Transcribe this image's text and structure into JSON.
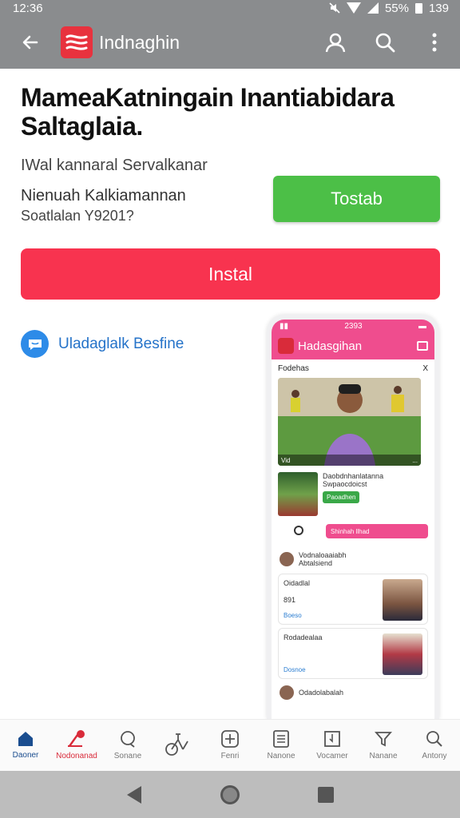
{
  "status_bar": {
    "time": "12:36",
    "battery": "55%",
    "right_extra": "139"
  },
  "app_bar": {
    "title": "Indnaghin"
  },
  "page": {
    "title": "MameaKatningain Inantiabidara Saltaglaia.",
    "subtitle": "IWal kannaral Servalkanar",
    "info_line1": "Nienuah Kalkiamannan",
    "info_line2": "Soatlalan Y9201?",
    "secondary_button": "Tostab",
    "primary_button": "Instal",
    "promo_link": "Uladaglalk Besfine"
  },
  "phone": {
    "status_time": "2393",
    "title": "Hadasgihan",
    "section_title": "Fodehas",
    "section_close": "X",
    "feature_caption_left": "Vid",
    "feature_caption_right": "...",
    "card_title": "Daobdnhanlatanna",
    "card_sub": "Swpaocdoicst",
    "card_chip": "Paoadhen",
    "pink_pill": "Shinhah llhad",
    "list_head": "Vodnaloaaiabh",
    "list_sub": "Abtalsiend",
    "news1_title": "Oidadlal",
    "news1_sub": "891",
    "news1_tag": "Boeso",
    "news2_title": "Rodadealaa",
    "news2_tag": "Dosnoe",
    "news3_title": "Odadolabalah"
  },
  "bottom_nav": [
    {
      "label": "Daoner",
      "icon": "home-icon"
    },
    {
      "label": "Nodonanad",
      "icon": "pen-icon"
    },
    {
      "label": "Sonane",
      "icon": "chat-icon"
    },
    {
      "label": "",
      "icon": "bike-icon"
    },
    {
      "label": "Fenri",
      "icon": "plus-box-icon"
    },
    {
      "label": "Nanone",
      "icon": "news-icon"
    },
    {
      "label": "Vocamer",
      "icon": "bookmark-icon"
    },
    {
      "label": "Nanane",
      "icon": "filter-icon"
    },
    {
      "label": "Antony",
      "icon": "search-icon"
    }
  ],
  "colors": {
    "install": "#f8334f",
    "tostab": "#4cbf47",
    "app_bar": "#8a8c8e",
    "link": "#2573c9"
  }
}
